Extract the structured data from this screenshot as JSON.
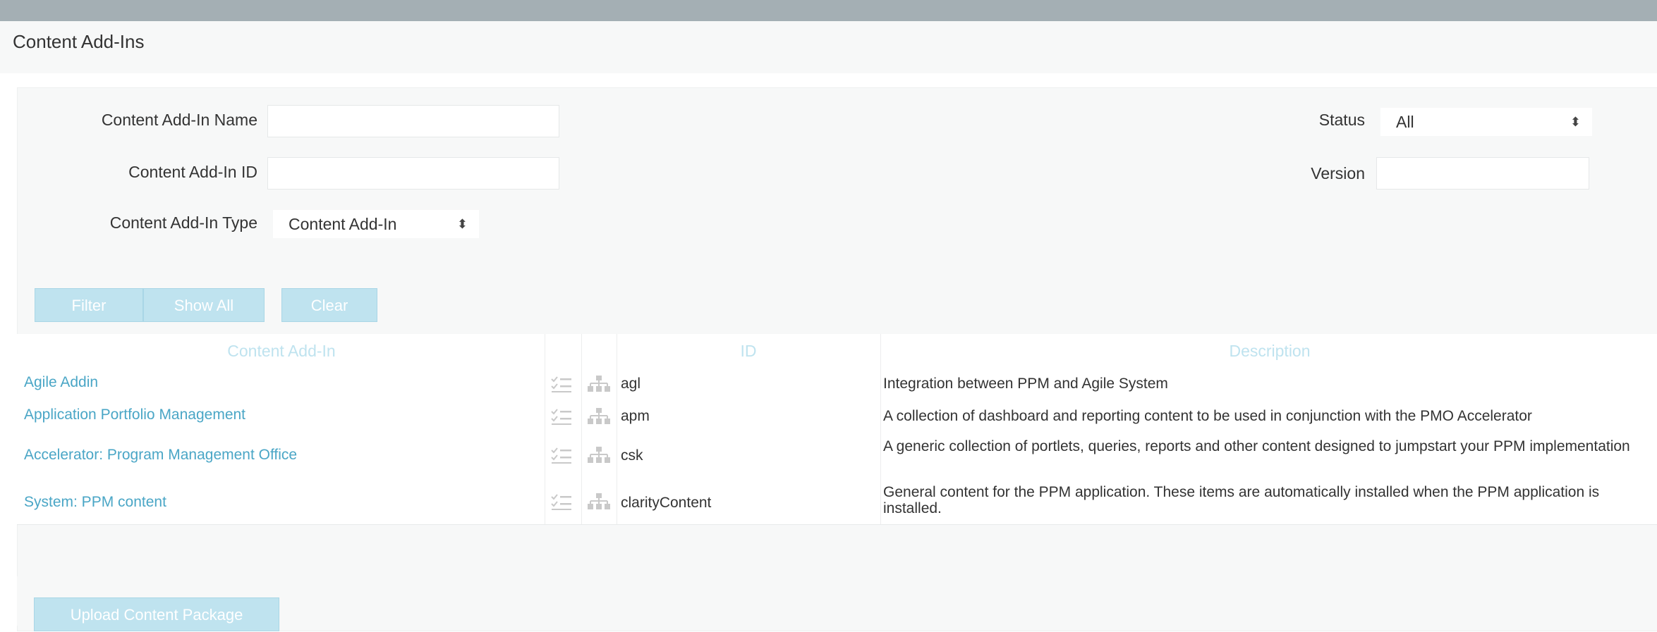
{
  "page": {
    "title": "Content Add-Ins"
  },
  "filter": {
    "name_label": "Content Add-In Name",
    "name_value": "",
    "id_label": "Content Add-In ID",
    "id_value": "",
    "type_label": "Content Add-In Type",
    "type_value": "Content Add-In",
    "status_label": "Status",
    "status_value": "All",
    "version_label": "Version",
    "version_value": ""
  },
  "buttons": {
    "filter": "Filter",
    "show_all": "Show All",
    "clear": "Clear",
    "upload": "Upload Content Package"
  },
  "table": {
    "headers": {
      "name": "Content Add-In",
      "id": "ID",
      "description": "Description"
    },
    "rows": [
      {
        "name": "Agile Addin",
        "id": "agl",
        "description": "Integration between PPM and Agile System"
      },
      {
        "name": "Application Portfolio Management",
        "id": "apm",
        "description": "A collection of dashboard and reporting content to be used in conjunction with the PMO Accelerator"
      },
      {
        "name": "Accelerator: Program Management Office",
        "id": "csk",
        "description": "A generic collection of portlets, queries, reports and other content designed to jumpstart your PPM implementation"
      },
      {
        "name": "System: PPM content",
        "id": "clarityContent",
        "description": "General content for the PPM application. These items are automatically installed when the PPM application is installed."
      }
    ]
  },
  "icons": {
    "row_checklist": "checklist-icon",
    "row_hierarchy": "hierarchy-icon"
  },
  "colors": {
    "link": "#4aa6c6",
    "button": "#bfe3ef",
    "header_text": "#bfe3ef",
    "topbar": "#a4afb4"
  }
}
